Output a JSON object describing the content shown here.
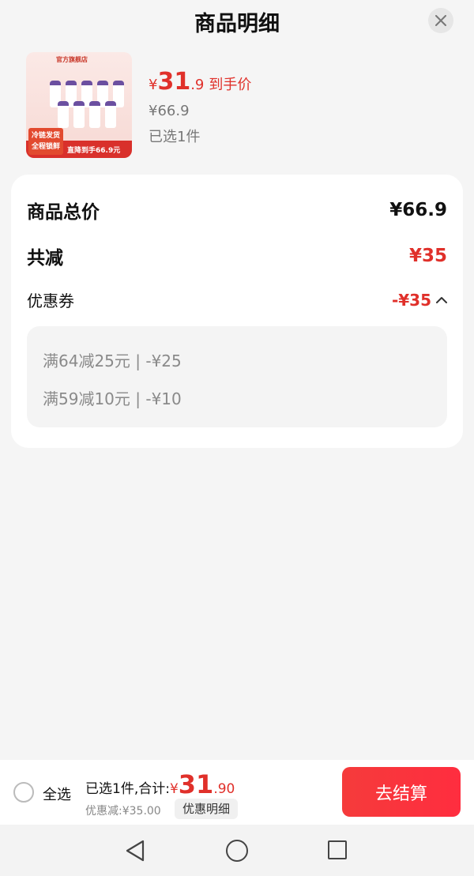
{
  "header": {
    "title": "商品明细",
    "close_icon": "close-icon"
  },
  "product": {
    "thumbnail": {
      "official_tag": "官方旗舰店",
      "cold_chain_line1": "冷链发货",
      "cold_chain_line2": "全程锁鲜",
      "drop_text": "直降到手66.9元"
    },
    "price_yen": "¥",
    "price_int": "31",
    "price_dec": ".9",
    "price_suffix": "到手价",
    "original_price": "¥66.9",
    "selected_count": "已选1件"
  },
  "summary_card": {
    "total_label": "商品总价",
    "total_value": "¥66.9",
    "reduce_label": "共减",
    "reduce_value": "¥35",
    "coupon_label": "优惠券",
    "coupon_value": "-¥35",
    "coupon_details": [
      "满64减25元 | -¥25",
      "满59减10元 | -¥10"
    ]
  },
  "bottom_bar": {
    "select_all": "全选",
    "selected_total_label": "已选1件,合计:",
    "total_yen": "¥",
    "total_int": "31",
    "total_dec": ".90",
    "discount_text": "优惠减:¥35.00",
    "detail_button": "优惠明细",
    "checkout_button": "去结算"
  },
  "colors": {
    "accent_red": "#e0302a",
    "checkout_red": "#ff2d3f",
    "background": "#f5f5f5"
  }
}
